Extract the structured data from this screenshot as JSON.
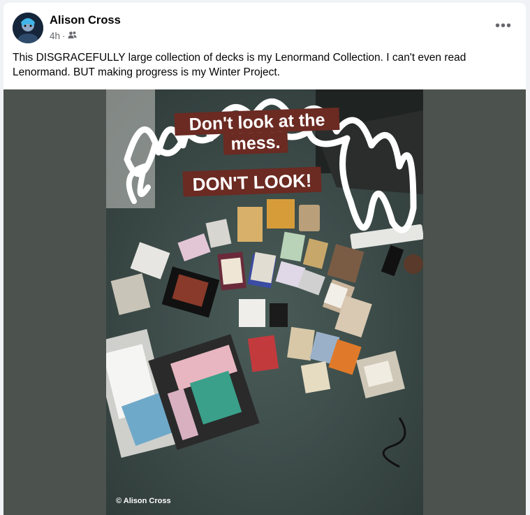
{
  "post": {
    "author": "Alison Cross",
    "time": "4h",
    "separator": "·",
    "audience_icon": "friends-icon",
    "more_icon": "more-options-icon",
    "more_label": "•••",
    "text": "This DISGRACEFULLY large collection of decks is my Lenormand Collection. I can't even read Lenormand. BUT making progress is my Winter Project."
  },
  "photo": {
    "caption_line1": "Don't look at the",
    "caption_line2": "mess.",
    "caption_line3": "DON'T LOOK!",
    "watermark": "© Alison Cross"
  },
  "colors": {
    "caption_bg": "#6b2a22",
    "media_bg": "#4c524e",
    "carpet": "#3a4a47"
  }
}
